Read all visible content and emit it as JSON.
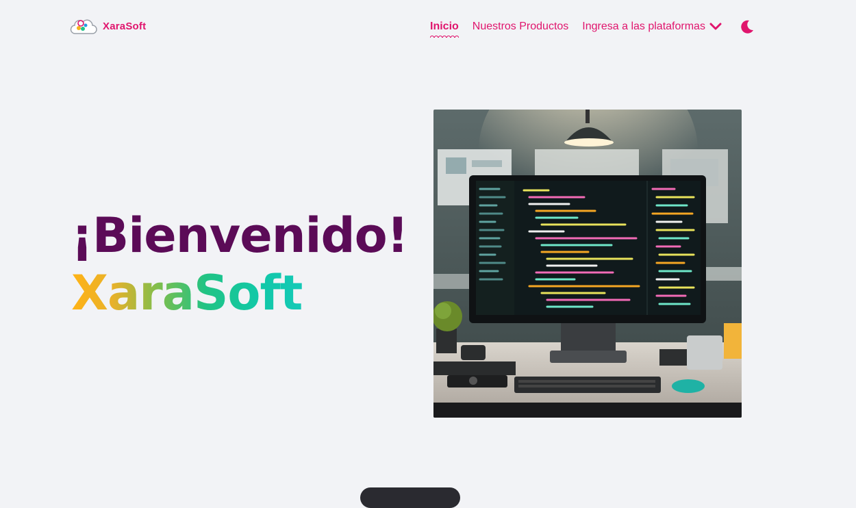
{
  "brand": {
    "name": "XaraSoft"
  },
  "nav": {
    "items": [
      {
        "label": "Inicio",
        "active": true
      },
      {
        "label": "Nuestros Productos",
        "active": false
      }
    ],
    "dropdown_label": "Ingresa a las plataformas",
    "theme_icon": "moon-icon"
  },
  "hero": {
    "title": "¡Bienvenido!",
    "brand": "XaraSoft",
    "image_alt": "workspace-computer-code"
  },
  "colors": {
    "accent": "#e0156d",
    "title": "#5b0b57",
    "background": "#f2f3f6",
    "gradient": [
      "#ffb316",
      "#7dbe4d",
      "#21c384",
      "#14c9b7"
    ]
  }
}
